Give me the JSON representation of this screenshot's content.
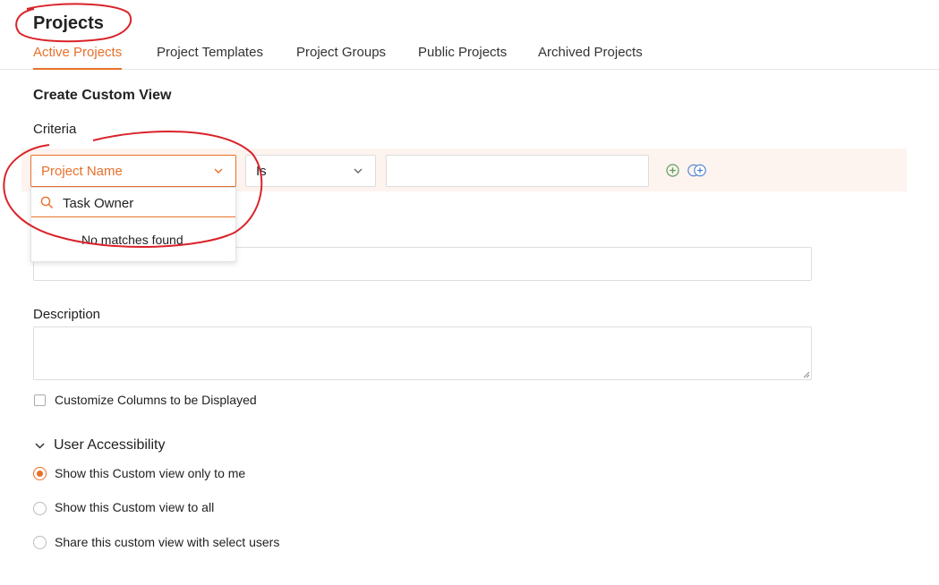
{
  "page": {
    "title": "Projects"
  },
  "tabs": [
    {
      "label": "Active Projects",
      "active": true
    },
    {
      "label": "Project Templates",
      "active": false
    },
    {
      "label": "Project Groups",
      "active": false
    },
    {
      "label": "Public Projects",
      "active": false
    },
    {
      "label": "Archived Projects",
      "active": false
    }
  ],
  "form": {
    "section_title": "Create Custom View",
    "criteria_label": "Criteria",
    "criteria": {
      "field": "Project Name",
      "operator": "Is",
      "value": ""
    },
    "dropdown": {
      "search_value": "Task Owner",
      "empty_message": "No matches found"
    },
    "name_value": "",
    "description_label": "Description",
    "description_value": "",
    "customize_columns_label": "Customize Columns to be Displayed",
    "customize_columns_checked": false,
    "accessibility": {
      "title": "User Accessibility",
      "options": [
        {
          "label": "Show this Custom view only to me",
          "selected": true
        },
        {
          "label": "Show this Custom view to all",
          "selected": false
        },
        {
          "label": "Share this custom view with select users",
          "selected": false
        }
      ]
    }
  },
  "colors": {
    "accent": "#e8702a",
    "criteria_row_bg": "#fdf3ef",
    "annotation": "#d9232a",
    "add_icon": "#5aa05a",
    "add_group_icon": "#4a7fd0"
  },
  "icons": {
    "dropdown_chevron": "chevron-down-icon",
    "search": "search-icon",
    "add_condition": "add-circle-icon",
    "add_group": "add-group-icon",
    "section_toggle": "chevron-down-icon"
  }
}
